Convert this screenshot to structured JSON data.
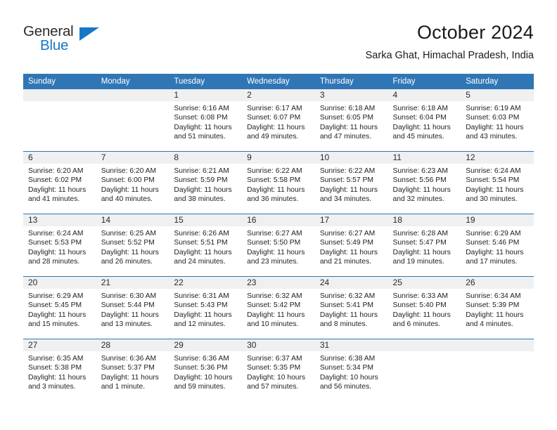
{
  "brand": {
    "name_part1": "General",
    "name_part2": "Blue",
    "accent_color": "#1878c8"
  },
  "header": {
    "title": "October 2024",
    "subtitle": "Sarka Ghat, Himachal Pradesh, India"
  },
  "theme": {
    "header_blue": "#3076B5",
    "daynum_band": "#f0f0f0",
    "text": "#222222"
  },
  "weekday_headers": [
    "Sunday",
    "Monday",
    "Tuesday",
    "Wednesday",
    "Thursday",
    "Friday",
    "Saturday"
  ],
  "labels": {
    "sunrise_prefix": "Sunrise:",
    "sunset_prefix": "Sunset:",
    "daylight_prefix": "Daylight:"
  },
  "weeks": [
    [
      {
        "day": "",
        "line1": "",
        "line2": "",
        "line3": "",
        "line4": ""
      },
      {
        "day": "",
        "line1": "",
        "line2": "",
        "line3": "",
        "line4": ""
      },
      {
        "day": "1",
        "line1": "Sunrise: 6:16 AM",
        "line2": "Sunset: 6:08 PM",
        "line3": "Daylight: 11 hours",
        "line4": "and 51 minutes."
      },
      {
        "day": "2",
        "line1": "Sunrise: 6:17 AM",
        "line2": "Sunset: 6:07 PM",
        "line3": "Daylight: 11 hours",
        "line4": "and 49 minutes."
      },
      {
        "day": "3",
        "line1": "Sunrise: 6:18 AM",
        "line2": "Sunset: 6:05 PM",
        "line3": "Daylight: 11 hours",
        "line4": "and 47 minutes."
      },
      {
        "day": "4",
        "line1": "Sunrise: 6:18 AM",
        "line2": "Sunset: 6:04 PM",
        "line3": "Daylight: 11 hours",
        "line4": "and 45 minutes."
      },
      {
        "day": "5",
        "line1": "Sunrise: 6:19 AM",
        "line2": "Sunset: 6:03 PM",
        "line3": "Daylight: 11 hours",
        "line4": "and 43 minutes."
      }
    ],
    [
      {
        "day": "6",
        "line1": "Sunrise: 6:20 AM",
        "line2": "Sunset: 6:02 PM",
        "line3": "Daylight: 11 hours",
        "line4": "and 41 minutes."
      },
      {
        "day": "7",
        "line1": "Sunrise: 6:20 AM",
        "line2": "Sunset: 6:00 PM",
        "line3": "Daylight: 11 hours",
        "line4": "and 40 minutes."
      },
      {
        "day": "8",
        "line1": "Sunrise: 6:21 AM",
        "line2": "Sunset: 5:59 PM",
        "line3": "Daylight: 11 hours",
        "line4": "and 38 minutes."
      },
      {
        "day": "9",
        "line1": "Sunrise: 6:22 AM",
        "line2": "Sunset: 5:58 PM",
        "line3": "Daylight: 11 hours",
        "line4": "and 36 minutes."
      },
      {
        "day": "10",
        "line1": "Sunrise: 6:22 AM",
        "line2": "Sunset: 5:57 PM",
        "line3": "Daylight: 11 hours",
        "line4": "and 34 minutes."
      },
      {
        "day": "11",
        "line1": "Sunrise: 6:23 AM",
        "line2": "Sunset: 5:56 PM",
        "line3": "Daylight: 11 hours",
        "line4": "and 32 minutes."
      },
      {
        "day": "12",
        "line1": "Sunrise: 6:24 AM",
        "line2": "Sunset: 5:54 PM",
        "line3": "Daylight: 11 hours",
        "line4": "and 30 minutes."
      }
    ],
    [
      {
        "day": "13",
        "line1": "Sunrise: 6:24 AM",
        "line2": "Sunset: 5:53 PM",
        "line3": "Daylight: 11 hours",
        "line4": "and 28 minutes."
      },
      {
        "day": "14",
        "line1": "Sunrise: 6:25 AM",
        "line2": "Sunset: 5:52 PM",
        "line3": "Daylight: 11 hours",
        "line4": "and 26 minutes."
      },
      {
        "day": "15",
        "line1": "Sunrise: 6:26 AM",
        "line2": "Sunset: 5:51 PM",
        "line3": "Daylight: 11 hours",
        "line4": "and 24 minutes."
      },
      {
        "day": "16",
        "line1": "Sunrise: 6:27 AM",
        "line2": "Sunset: 5:50 PM",
        "line3": "Daylight: 11 hours",
        "line4": "and 23 minutes."
      },
      {
        "day": "17",
        "line1": "Sunrise: 6:27 AM",
        "line2": "Sunset: 5:49 PM",
        "line3": "Daylight: 11 hours",
        "line4": "and 21 minutes."
      },
      {
        "day": "18",
        "line1": "Sunrise: 6:28 AM",
        "line2": "Sunset: 5:47 PM",
        "line3": "Daylight: 11 hours",
        "line4": "and 19 minutes."
      },
      {
        "day": "19",
        "line1": "Sunrise: 6:29 AM",
        "line2": "Sunset: 5:46 PM",
        "line3": "Daylight: 11 hours",
        "line4": "and 17 minutes."
      }
    ],
    [
      {
        "day": "20",
        "line1": "Sunrise: 6:29 AM",
        "line2": "Sunset: 5:45 PM",
        "line3": "Daylight: 11 hours",
        "line4": "and 15 minutes."
      },
      {
        "day": "21",
        "line1": "Sunrise: 6:30 AM",
        "line2": "Sunset: 5:44 PM",
        "line3": "Daylight: 11 hours",
        "line4": "and 13 minutes."
      },
      {
        "day": "22",
        "line1": "Sunrise: 6:31 AM",
        "line2": "Sunset: 5:43 PM",
        "line3": "Daylight: 11 hours",
        "line4": "and 12 minutes."
      },
      {
        "day": "23",
        "line1": "Sunrise: 6:32 AM",
        "line2": "Sunset: 5:42 PM",
        "line3": "Daylight: 11 hours",
        "line4": "and 10 minutes."
      },
      {
        "day": "24",
        "line1": "Sunrise: 6:32 AM",
        "line2": "Sunset: 5:41 PM",
        "line3": "Daylight: 11 hours",
        "line4": "and 8 minutes."
      },
      {
        "day": "25",
        "line1": "Sunrise: 6:33 AM",
        "line2": "Sunset: 5:40 PM",
        "line3": "Daylight: 11 hours",
        "line4": "and 6 minutes."
      },
      {
        "day": "26",
        "line1": "Sunrise: 6:34 AM",
        "line2": "Sunset: 5:39 PM",
        "line3": "Daylight: 11 hours",
        "line4": "and 4 minutes."
      }
    ],
    [
      {
        "day": "27",
        "line1": "Sunrise: 6:35 AM",
        "line2": "Sunset: 5:38 PM",
        "line3": "Daylight: 11 hours",
        "line4": "and 3 minutes."
      },
      {
        "day": "28",
        "line1": "Sunrise: 6:36 AM",
        "line2": "Sunset: 5:37 PM",
        "line3": "Daylight: 11 hours",
        "line4": "and 1 minute."
      },
      {
        "day": "29",
        "line1": "Sunrise: 6:36 AM",
        "line2": "Sunset: 5:36 PM",
        "line3": "Daylight: 10 hours",
        "line4": "and 59 minutes."
      },
      {
        "day": "30",
        "line1": "Sunrise: 6:37 AM",
        "line2": "Sunset: 5:35 PM",
        "line3": "Daylight: 10 hours",
        "line4": "and 57 minutes."
      },
      {
        "day": "31",
        "line1": "Sunrise: 6:38 AM",
        "line2": "Sunset: 5:34 PM",
        "line3": "Daylight: 10 hours",
        "line4": "and 56 minutes."
      },
      {
        "day": "",
        "line1": "",
        "line2": "",
        "line3": "",
        "line4": ""
      },
      {
        "day": "",
        "line1": "",
        "line2": "",
        "line3": "",
        "line4": ""
      }
    ]
  ]
}
